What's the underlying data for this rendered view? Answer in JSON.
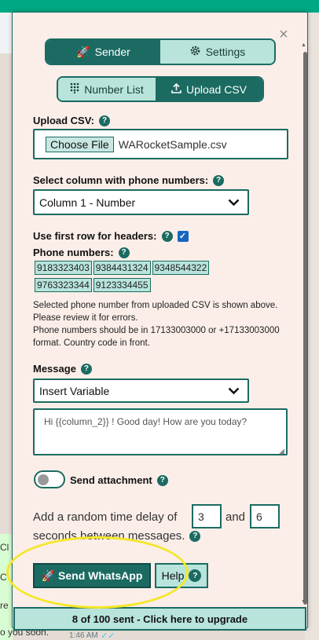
{
  "panel": {
    "close_label": "×",
    "main_tabs": [
      {
        "label": "Sender",
        "icon": "rocket-icon",
        "active": true
      },
      {
        "label": "Settings",
        "icon": "gear-icon",
        "active": false
      }
    ],
    "sub_tabs": [
      {
        "label": "Number List",
        "icon": "keypad-icon",
        "active": false
      },
      {
        "label": "Upload CSV",
        "icon": "upload-icon",
        "active": true
      }
    ],
    "upload": {
      "label": "Upload CSV:",
      "button": "Choose File",
      "file_name": "WARocketSample.csv"
    },
    "column_select": {
      "label": "Select column with phone numbers:",
      "value": "Column 1 - Number"
    },
    "headers_checkbox": {
      "label": "Use first row for headers:",
      "checked": true
    },
    "phones": {
      "label": "Phone numbers:",
      "rows": [
        [
          "9183323403",
          "9384431324",
          "9348544322"
        ],
        [
          "9763323344",
          "9123334455"
        ]
      ]
    },
    "notes": [
      "Selected phone number from uploaded CSV is shown above. Please review it for errors.",
      "Phone numbers should be in 17133003000 or +17133003000 format. Country code in front."
    ],
    "message": {
      "label": "Message",
      "variable_select": "Insert Variable",
      "text": "Hi {{column_2}} ! Good day! How are you today?"
    },
    "attachment": {
      "label": "Send attachment",
      "enabled": false
    },
    "delay": {
      "prefix": "Add a random time delay of",
      "min": "3",
      "and": "and",
      "max": "6",
      "suffix": "seconds between messages."
    },
    "send_button": "Send WhatsApp",
    "help_button": "Help",
    "upgrade_bar": "8 of 100 sent - Click here to upgrade"
  },
  "background": {
    "bubbles": [
      "Cl",
      "C",
      "re",
      "o you soon."
    ],
    "time": "1:46 AM",
    "check": "✓✓"
  },
  "colors": {
    "primary": "#1b6b62",
    "light": "#b8e4dc",
    "panel_bg": "#fbeee9",
    "highlight": "#f5e72a"
  }
}
